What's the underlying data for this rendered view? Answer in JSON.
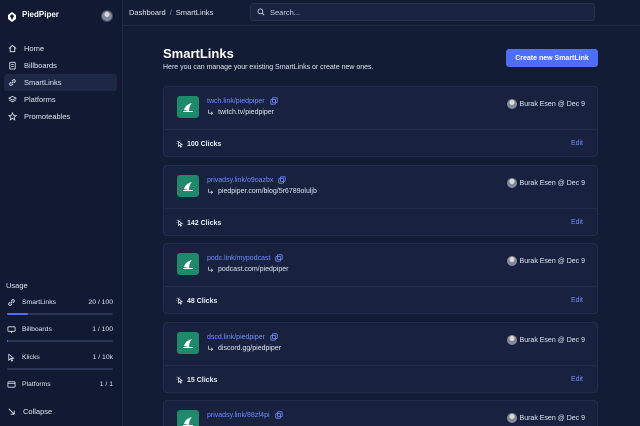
{
  "brand": {
    "name": "PiedPiper"
  },
  "sidebar": {
    "items": [
      {
        "label": "Home",
        "icon": "home-icon"
      },
      {
        "label": "Billboards",
        "icon": "clipboard-icon"
      },
      {
        "label": "SmartLinks",
        "icon": "link-icon",
        "active": true
      },
      {
        "label": "Platforms",
        "icon": "stack-icon"
      },
      {
        "label": "Promoteables",
        "icon": "star-icon"
      }
    ],
    "usage_title": "Usage",
    "usage": [
      {
        "label": "SmartLinks",
        "value": "20 / 100",
        "fraction": 0.2,
        "icon": "link-icon"
      },
      {
        "label": "Billboards",
        "value": "1 / 100",
        "fraction": 0.01,
        "icon": "billboard-icon"
      },
      {
        "label": "Klicks",
        "value": "1 / 10k",
        "fraction": 0.0,
        "icon": "cursor-icon"
      },
      {
        "label": "Platforms",
        "value": "1 / 1",
        "fraction": 1.0,
        "icon": "platform-icon"
      }
    ],
    "collapse_label": "Collapse"
  },
  "breadcrumb": {
    "root": "Dashboard",
    "separator": "/",
    "current": "SmartLinks"
  },
  "search": {
    "placeholder": "Search..."
  },
  "page": {
    "title": "SmartLinks",
    "subtitle": "Here you can manage your existing SmartLinks or create new ones.",
    "create_label": "Create new SmartLink"
  },
  "cards": [
    {
      "short": "twch.link/piedpiper",
      "dest": "twitch.tv/piedpiper",
      "author": "Burak Esen @ Dec 9",
      "clicks": "100 Clicks",
      "edit": "Edit"
    },
    {
      "short": "privadsy.link/o9oazbx",
      "dest": "piedpiper.com/blog/5r6789oluljb",
      "author": "Burak Esen @ Dec 9",
      "clicks": "142 Clicks",
      "edit": "Edit"
    },
    {
      "short": "podc.link/mypodcast",
      "dest": "podcast.com/piedpiper",
      "author": "Burak Esen @ Dec 9",
      "clicks": "48 Clicks",
      "edit": "Edit"
    },
    {
      "short": "dscd.link/piedpiper",
      "dest": "discord.gg/piedpiper",
      "author": "Burak Esen @ Dec 9",
      "clicks": "15 Clicks",
      "edit": "Edit"
    },
    {
      "short": "privadsy.link/88zf4pi",
      "dest": "",
      "author": "Burak Esen @ Dec 9",
      "clicks": "",
      "edit": ""
    }
  ],
  "colors": {
    "accent": "#4f6ef7",
    "link": "#6f8cff",
    "logo_bg": "#1f8a6b",
    "background": "#131c35"
  }
}
